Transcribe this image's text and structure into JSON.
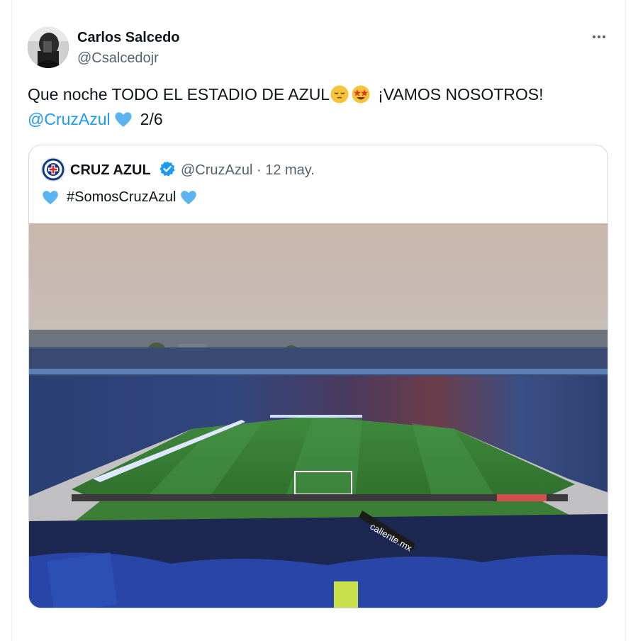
{
  "tweet": {
    "author_name": "Carlos Salcedo",
    "author_handle": "@Csalcedojr",
    "text_line1": "Que noche TODO EL ESTADIO DE AZUL",
    "text_line1_tail": "¡VAMOS NOSOTROS!",
    "mention": "@CruzAzul",
    "thread_count": "2/6",
    "emojis": [
      "relieved-face",
      "star-struck",
      "light-blue-heart"
    ]
  },
  "quoted_tweet": {
    "author_name": "CRUZ AZUL",
    "verified": true,
    "handle_date": "@CruzAzul · 12 may.",
    "hashtag": "#SomosCruzAzul",
    "emojis": [
      "light-blue-heart",
      "light-blue-heart"
    ],
    "image": {
      "description_icon": "stadium-photo",
      "billboard_text": "caliente.mx"
    }
  },
  "colors": {
    "link": "#1d9bf0",
    "secondary_text": "#536471",
    "heart": "#5bb4f0",
    "verified": "#1d9bf0"
  }
}
